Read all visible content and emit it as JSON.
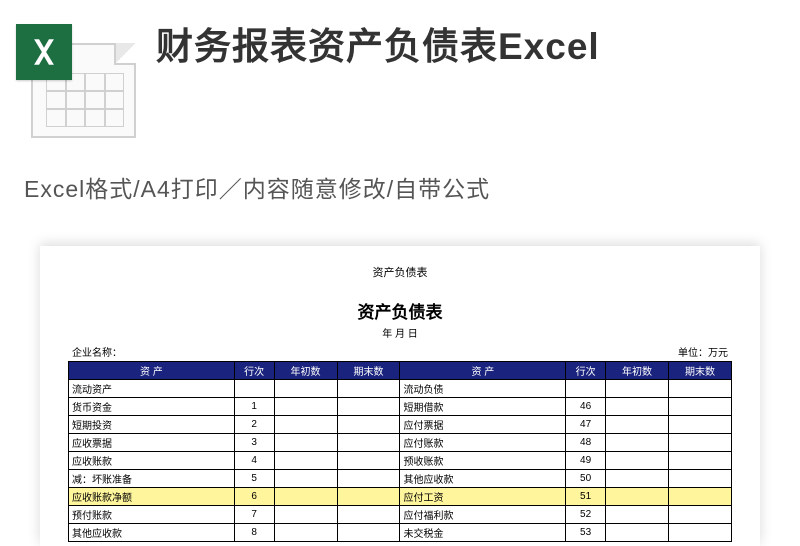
{
  "header": {
    "title": "财务报表资产负债表Excel",
    "subtitle": "Excel格式/A4打印／内容随意修改/自带公式"
  },
  "preview": {
    "top_caption": "资产负债表",
    "main_title": "资产负债表",
    "date_line": "年    月    日",
    "company_label": "企业名称：",
    "unit_label": "单位：万元",
    "columns": {
      "asset": "资        产",
      "line": "行次",
      "open": "年初数",
      "end": "期末数",
      "liab": "资        产"
    },
    "rows": [
      {
        "a": "流动资产",
        "ai": "",
        "l": "流动负债",
        "li": "",
        "hl": false
      },
      {
        "a": "货币资金",
        "ai": "1",
        "l": "短期借款",
        "li": "46",
        "hl": false
      },
      {
        "a": "短期投资",
        "ai": "2",
        "l": "应付票据",
        "li": "47",
        "hl": false
      },
      {
        "a": "应收票据",
        "ai": "3",
        "l": "应付账款",
        "li": "48",
        "hl": false
      },
      {
        "a": "应收账款",
        "ai": "4",
        "l": "预收账款",
        "li": "49",
        "hl": false
      },
      {
        "a": "减：坏账准备",
        "ai": "5",
        "l": "其他应收款",
        "li": "50",
        "hl": false
      },
      {
        "a": "应收账款净额",
        "ai": "6",
        "l": "应付工资",
        "li": "51",
        "hl": true
      },
      {
        "a": "预付账款",
        "ai": "7",
        "l": "应付福利款",
        "li": "52",
        "hl": false
      },
      {
        "a": "其他应收款",
        "ai": "8",
        "l": "未交税金",
        "li": "53",
        "hl": false
      }
    ]
  }
}
